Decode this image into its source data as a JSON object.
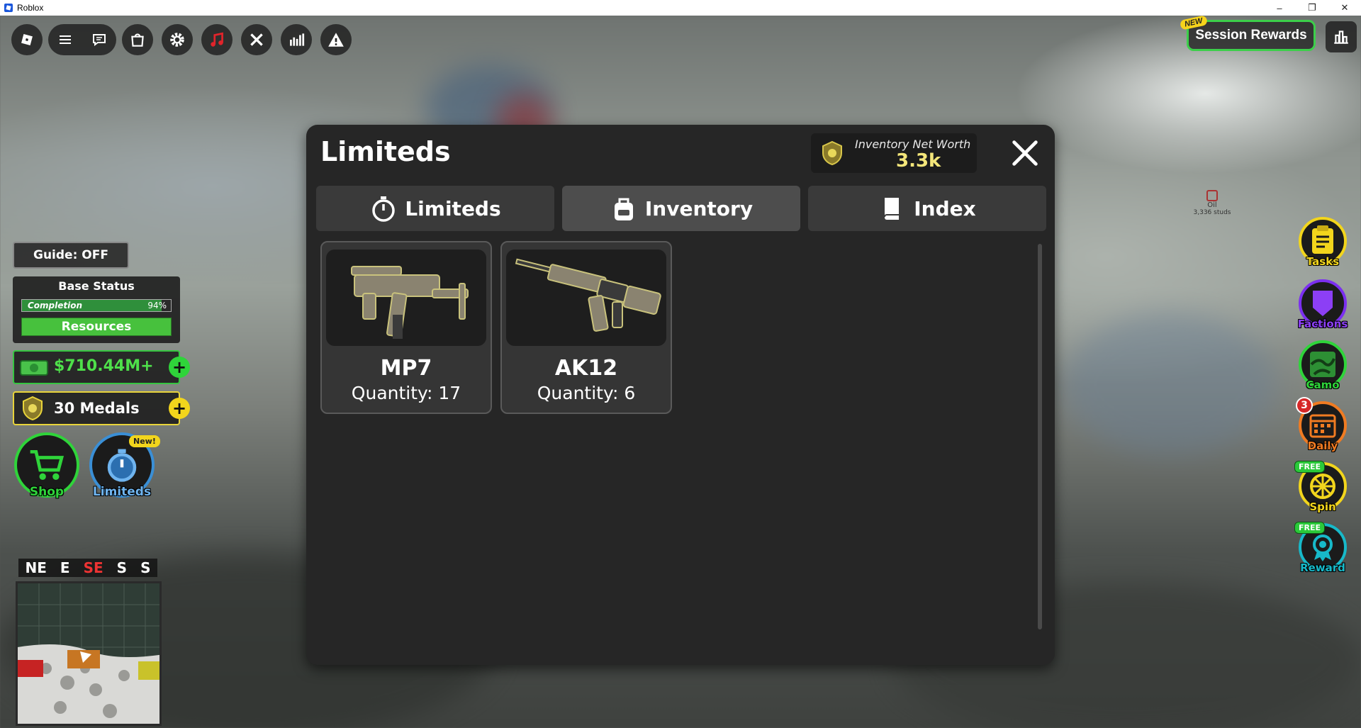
{
  "window": {
    "title": "Roblox",
    "controls": [
      "–",
      "❐",
      "✕"
    ]
  },
  "toolbar": {
    "icons": [
      "roblox-logo",
      "menu",
      "chat",
      "backpack",
      "settings",
      "music",
      "tools",
      "stats",
      "report"
    ]
  },
  "session": {
    "label": "Session Rewards",
    "new_tag": "NEW"
  },
  "modal": {
    "title": "Limiteds",
    "networth_label": "Inventory Net Worth",
    "networth_value": "3.3k",
    "tabs": [
      {
        "label": "Limiteds",
        "icon": "stopwatch-icon",
        "active": false
      },
      {
        "label": "Inventory",
        "icon": "backpack-icon",
        "active": true
      },
      {
        "label": "Index",
        "icon": "book-icon",
        "active": false
      }
    ],
    "items": [
      {
        "name": "MP7",
        "quantity": "Quantity: 17"
      },
      {
        "name": "AK12",
        "quantity": "Quantity: 6"
      }
    ]
  },
  "hud": {
    "guide": "Guide: OFF",
    "base_status": {
      "title": "Base Status",
      "completion_label": "Completion",
      "completion_pct": "94%",
      "completion_value": 0.94,
      "resources": "Resources"
    },
    "money": "$710.44M+",
    "medals": "30 Medals",
    "shop": "Shop",
    "limiteds": "Limiteds",
    "limiteds_new": "New!"
  },
  "compass": {
    "letters": [
      "NE",
      "E",
      "SE",
      "S",
      "S"
    ]
  },
  "right_hud": [
    {
      "label": "Tasks",
      "color": "#f2d51c"
    },
    {
      "label": "Factions",
      "color": "#7b2ff0"
    },
    {
      "label": "Camo",
      "color": "#2fd43a"
    },
    {
      "label": "Daily",
      "color": "#f07b22",
      "badge": "3"
    },
    {
      "label": "Spin",
      "color": "#f2d51c",
      "tag": "FREE"
    },
    {
      "label": "Reward",
      "color": "#17b9c9",
      "tag": "FREE"
    }
  ],
  "world": {
    "oil_label": "Oil",
    "oil_sub": "3,336 studs"
  }
}
